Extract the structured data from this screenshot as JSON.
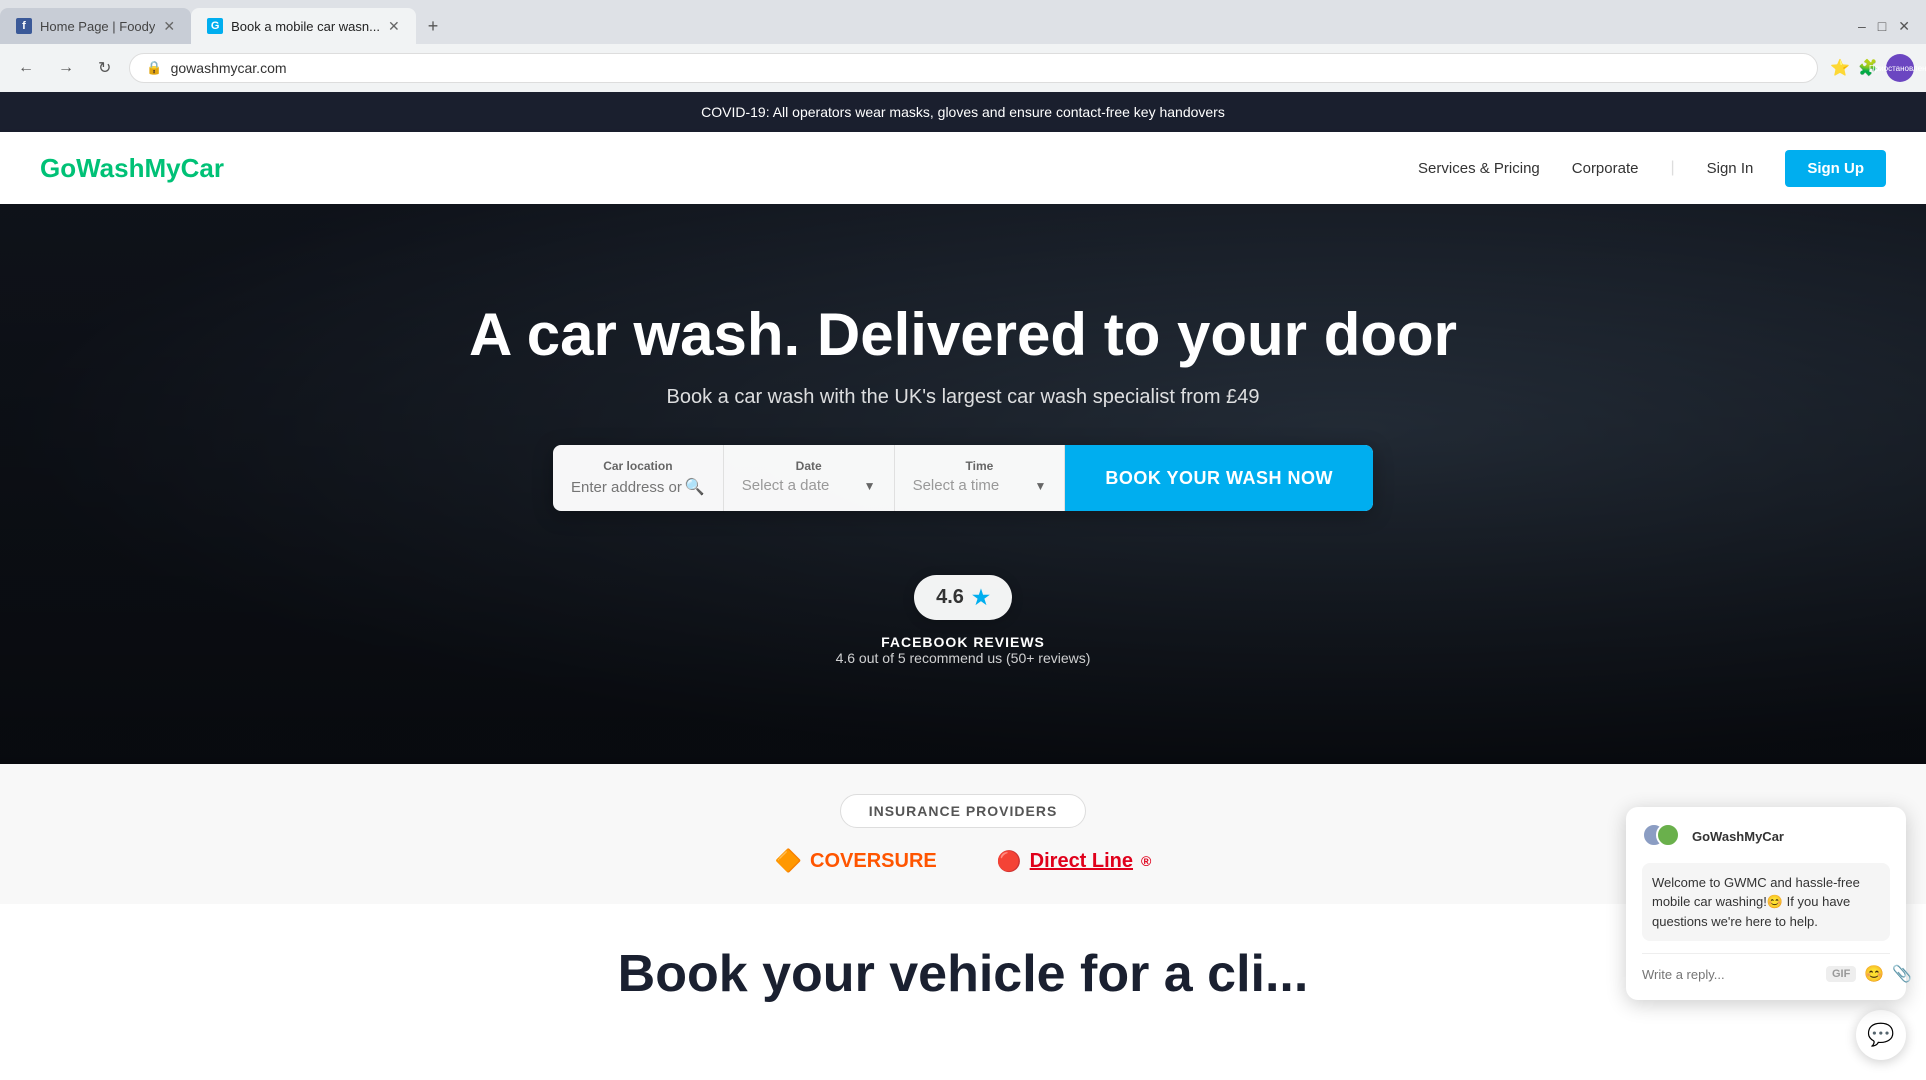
{
  "browser": {
    "tabs": [
      {
        "id": "tab-1",
        "label": "Home Page | Foody",
        "favicon": "F",
        "active": false
      },
      {
        "id": "tab-2",
        "label": "Book a mobile car wasn...",
        "favicon": "B",
        "active": true
      }
    ],
    "new_tab_label": "+",
    "address": "gowashmycar.com",
    "nav_back": "←",
    "nav_forward": "→",
    "nav_refresh": "↻",
    "profile_label": "Приостановлена"
  },
  "covid_banner": {
    "text": "COVID-19: All operators wear masks, gloves and ensure contact-free key handovers"
  },
  "navbar": {
    "logo_text": "GoWashMyCar",
    "links": [
      {
        "label": "Services & Pricing",
        "id": "services"
      },
      {
        "label": "Corporate",
        "id": "corporate"
      }
    ],
    "signin_label": "Sign In",
    "signup_label": "Sign Up"
  },
  "hero": {
    "title": "A car wash. Delivered to your door",
    "subtitle": "Book a car wash with the UK's largest car wash specialist from £49",
    "booking": {
      "location_label": "Car location",
      "location_placeholder": "Enter address or postcode",
      "date_label": "Date",
      "date_placeholder": "Select a date",
      "time_label": "Time",
      "time_placeholder": "Select a time",
      "book_button": "BOOK YOUR WASH NOW"
    }
  },
  "rating": {
    "score": "4.6",
    "star": "★",
    "section_title": "FACEBOOK REVIEWS",
    "section_subtitle": "4.6 out of 5 recommend us (50+ reviews)"
  },
  "insurance": {
    "badge_label": "INSURANCE PROVIDERS",
    "providers": [
      {
        "name": "COVERSURE",
        "icon": "🔶"
      },
      {
        "name": "Direct Line",
        "icon": "📞"
      }
    ]
  },
  "chat_widget": {
    "sender": "GoWashMyCar",
    "message": "Welcome to GWMC and hassle-free mobile car washing!😊 If you have questions we're here to help.",
    "input_placeholder": "Write a reply...",
    "gif_label": "GIF",
    "emoji_label": "😊",
    "attach_label": "📎"
  },
  "bottom_section": {
    "title": "Book your vehicle for a cli..."
  }
}
